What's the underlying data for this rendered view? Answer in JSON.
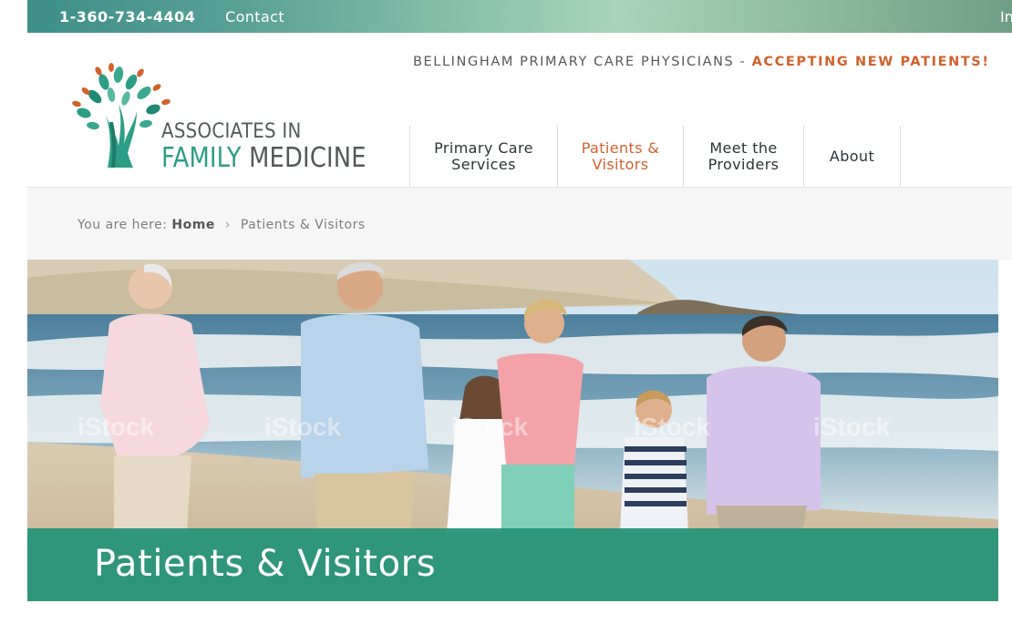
{
  "topbar": {
    "phone": "1-360-734-4404",
    "contact": "Contact",
    "cut_link": "In"
  },
  "header": {
    "tagline_main": "BELLINGHAM PRIMARY CARE PHYSICIANS - ",
    "tagline_accent": "ACCEPTING NEW PATIENTS!",
    "logo_line1": "ASSOCIATES IN",
    "logo_line2a": "FAMILY",
    "logo_line2b": " MEDICINE"
  },
  "nav": {
    "items": [
      {
        "label": "Primary Care\nServices"
      },
      {
        "label": "Patients &\nVisitors"
      },
      {
        "label": "Meet the\nProviders"
      },
      {
        "label": "About"
      }
    ]
  },
  "breadcrumb": {
    "prefix": "You are here:",
    "home": "Home",
    "separator": "›",
    "current": "Patients & Visitors"
  },
  "hero": {
    "title": "Patients & Visitors",
    "watermark": "iStock"
  },
  "colors": {
    "accent": "#d0622c",
    "brand_teal": "#2c9e85",
    "band": "#229278"
  }
}
